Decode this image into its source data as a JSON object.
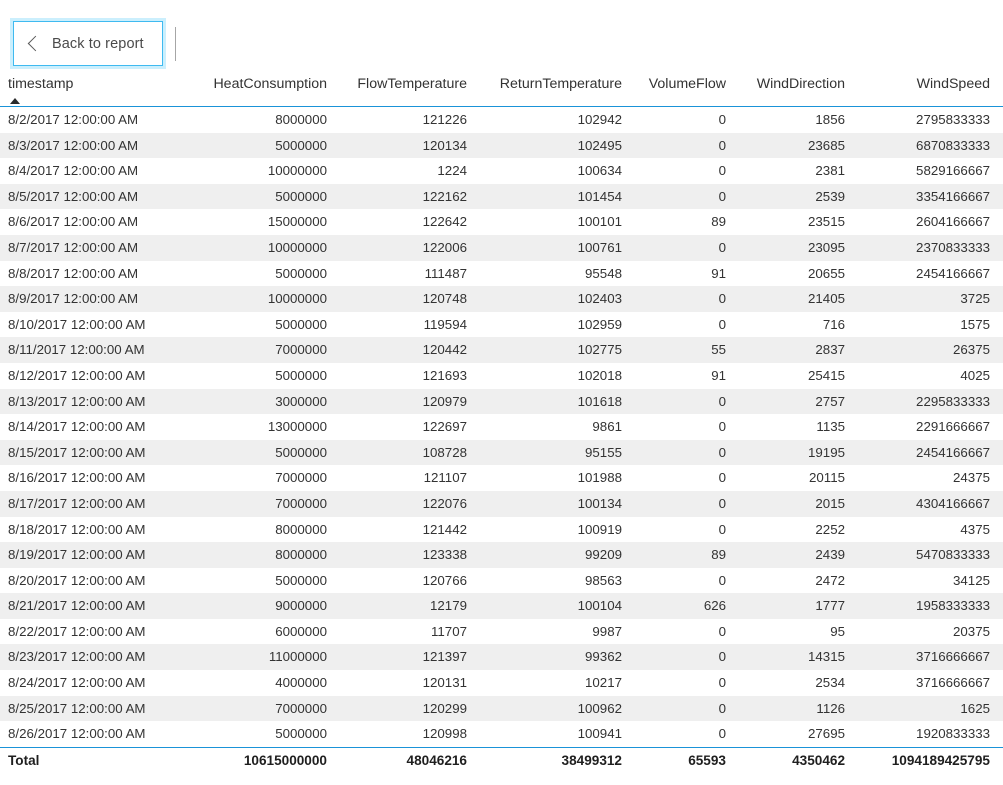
{
  "toolbar": {
    "back_label": "Back to report",
    "back_icon": "chevron-left-icon",
    "accent_color": "#3fbaf0"
  },
  "table": {
    "header_border_color": "#1a93d8",
    "alt_row_color": "#efefef",
    "sort_column": "timestamp",
    "sort_direction": "ascending",
    "columns": [
      {
        "key": "timestamp",
        "label": "timestamp",
        "align": "left"
      },
      {
        "key": "heat",
        "label": "HeatConsumption",
        "align": "right"
      },
      {
        "key": "flow",
        "label": "FlowTemperature",
        "align": "right"
      },
      {
        "key": "return",
        "label": "ReturnTemperature",
        "align": "right"
      },
      {
        "key": "volume",
        "label": "VolumeFlow",
        "align": "right"
      },
      {
        "key": "winddir",
        "label": "WindDirection",
        "align": "right"
      },
      {
        "key": "windspeed",
        "label": "WindSpeed",
        "align": "right"
      }
    ],
    "rows": [
      [
        "8/2/2017 12:00:00 AM",
        "8000000",
        "121226",
        "102942",
        "0",
        "1856",
        "2795833333"
      ],
      [
        "8/3/2017 12:00:00 AM",
        "5000000",
        "120134",
        "102495",
        "0",
        "23685",
        "6870833333"
      ],
      [
        "8/4/2017 12:00:00 AM",
        "10000000",
        "1224",
        "100634",
        "0",
        "2381",
        "5829166667"
      ],
      [
        "8/5/2017 12:00:00 AM",
        "5000000",
        "122162",
        "101454",
        "0",
        "2539",
        "3354166667"
      ],
      [
        "8/6/2017 12:00:00 AM",
        "15000000",
        "122642",
        "100101",
        "89",
        "23515",
        "2604166667"
      ],
      [
        "8/7/2017 12:00:00 AM",
        "10000000",
        "122006",
        "100761",
        "0",
        "23095",
        "2370833333"
      ],
      [
        "8/8/2017 12:00:00 AM",
        "5000000",
        "111487",
        "95548",
        "91",
        "20655",
        "2454166667"
      ],
      [
        "8/9/2017 12:00:00 AM",
        "10000000",
        "120748",
        "102403",
        "0",
        "21405",
        "3725"
      ],
      [
        "8/10/2017 12:00:00 AM",
        "5000000",
        "119594",
        "102959",
        "0",
        "716",
        "1575"
      ],
      [
        "8/11/2017 12:00:00 AM",
        "7000000",
        "120442",
        "102775",
        "55",
        "2837",
        "26375"
      ],
      [
        "8/12/2017 12:00:00 AM",
        "5000000",
        "121693",
        "102018",
        "91",
        "25415",
        "4025"
      ],
      [
        "8/13/2017 12:00:00 AM",
        "3000000",
        "120979",
        "101618",
        "0",
        "2757",
        "2295833333"
      ],
      [
        "8/14/2017 12:00:00 AM",
        "13000000",
        "122697",
        "9861",
        "0",
        "1135",
        "2291666667"
      ],
      [
        "8/15/2017 12:00:00 AM",
        "5000000",
        "108728",
        "95155",
        "0",
        "19195",
        "2454166667"
      ],
      [
        "8/16/2017 12:00:00 AM",
        "7000000",
        "121107",
        "101988",
        "0",
        "20115",
        "24375"
      ],
      [
        "8/17/2017 12:00:00 AM",
        "7000000",
        "122076",
        "100134",
        "0",
        "2015",
        "4304166667"
      ],
      [
        "8/18/2017 12:00:00 AM",
        "8000000",
        "121442",
        "100919",
        "0",
        "2252",
        "4375"
      ],
      [
        "8/19/2017 12:00:00 AM",
        "8000000",
        "123338",
        "99209",
        "89",
        "2439",
        "5470833333"
      ],
      [
        "8/20/2017 12:00:00 AM",
        "5000000",
        "120766",
        "98563",
        "0",
        "2472",
        "34125"
      ],
      [
        "8/21/2017 12:00:00 AM",
        "9000000",
        "12179",
        "100104",
        "626",
        "1777",
        "1958333333"
      ],
      [
        "8/22/2017 12:00:00 AM",
        "6000000",
        "11707",
        "9987",
        "0",
        "95",
        "20375"
      ],
      [
        "8/23/2017 12:00:00 AM",
        "11000000",
        "121397",
        "99362",
        "0",
        "14315",
        "3716666667"
      ],
      [
        "8/24/2017 12:00:00 AM",
        "4000000",
        "120131",
        "10217",
        "0",
        "2534",
        "3716666667"
      ],
      [
        "8/25/2017 12:00:00 AM",
        "7000000",
        "120299",
        "100962",
        "0",
        "1126",
        "1625"
      ],
      [
        "8/26/2017 12:00:00 AM",
        "5000000",
        "120998",
        "100941",
        "0",
        "27695",
        "1920833333"
      ]
    ],
    "total": [
      "Total",
      "10615000000",
      "48046216",
      "38499312",
      "65593",
      "4350462",
      "1094189425795"
    ]
  }
}
